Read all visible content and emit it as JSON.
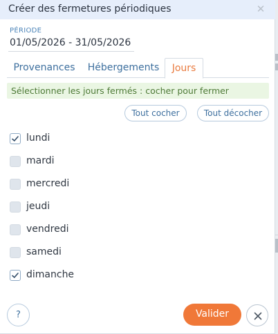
{
  "dialog": {
    "title": "Créer des fermetures périodiques",
    "close_icon": "close-icon"
  },
  "periode": {
    "label": "PÉRIODE",
    "value": "01/05/2026 - 31/05/2026"
  },
  "tabs": [
    {
      "label": "Provenances",
      "active": false
    },
    {
      "label": "Hébergements",
      "active": false
    },
    {
      "label": "Jours",
      "active": true
    }
  ],
  "info": {
    "text": "Sélectionner les jours fermés : cocher pour fermer"
  },
  "actions": {
    "check_all": "Tout cocher",
    "uncheck_all": "Tout décocher"
  },
  "days": [
    {
      "label": "lundi",
      "checked": true
    },
    {
      "label": "mardi",
      "checked": false
    },
    {
      "label": "mercredi",
      "checked": false
    },
    {
      "label": "jeudi",
      "checked": false
    },
    {
      "label": "vendredi",
      "checked": false
    },
    {
      "label": "samedi",
      "checked": false
    },
    {
      "label": "dimanche",
      "checked": true
    }
  ],
  "footer": {
    "help_label": "?",
    "submit_label": "Valider",
    "close_icon": "close-icon"
  },
  "colors": {
    "accent": "#f07838",
    "link": "#3d6f9e",
    "header_bg": "#e6eefb",
    "info_bg": "#eaf6e3"
  }
}
